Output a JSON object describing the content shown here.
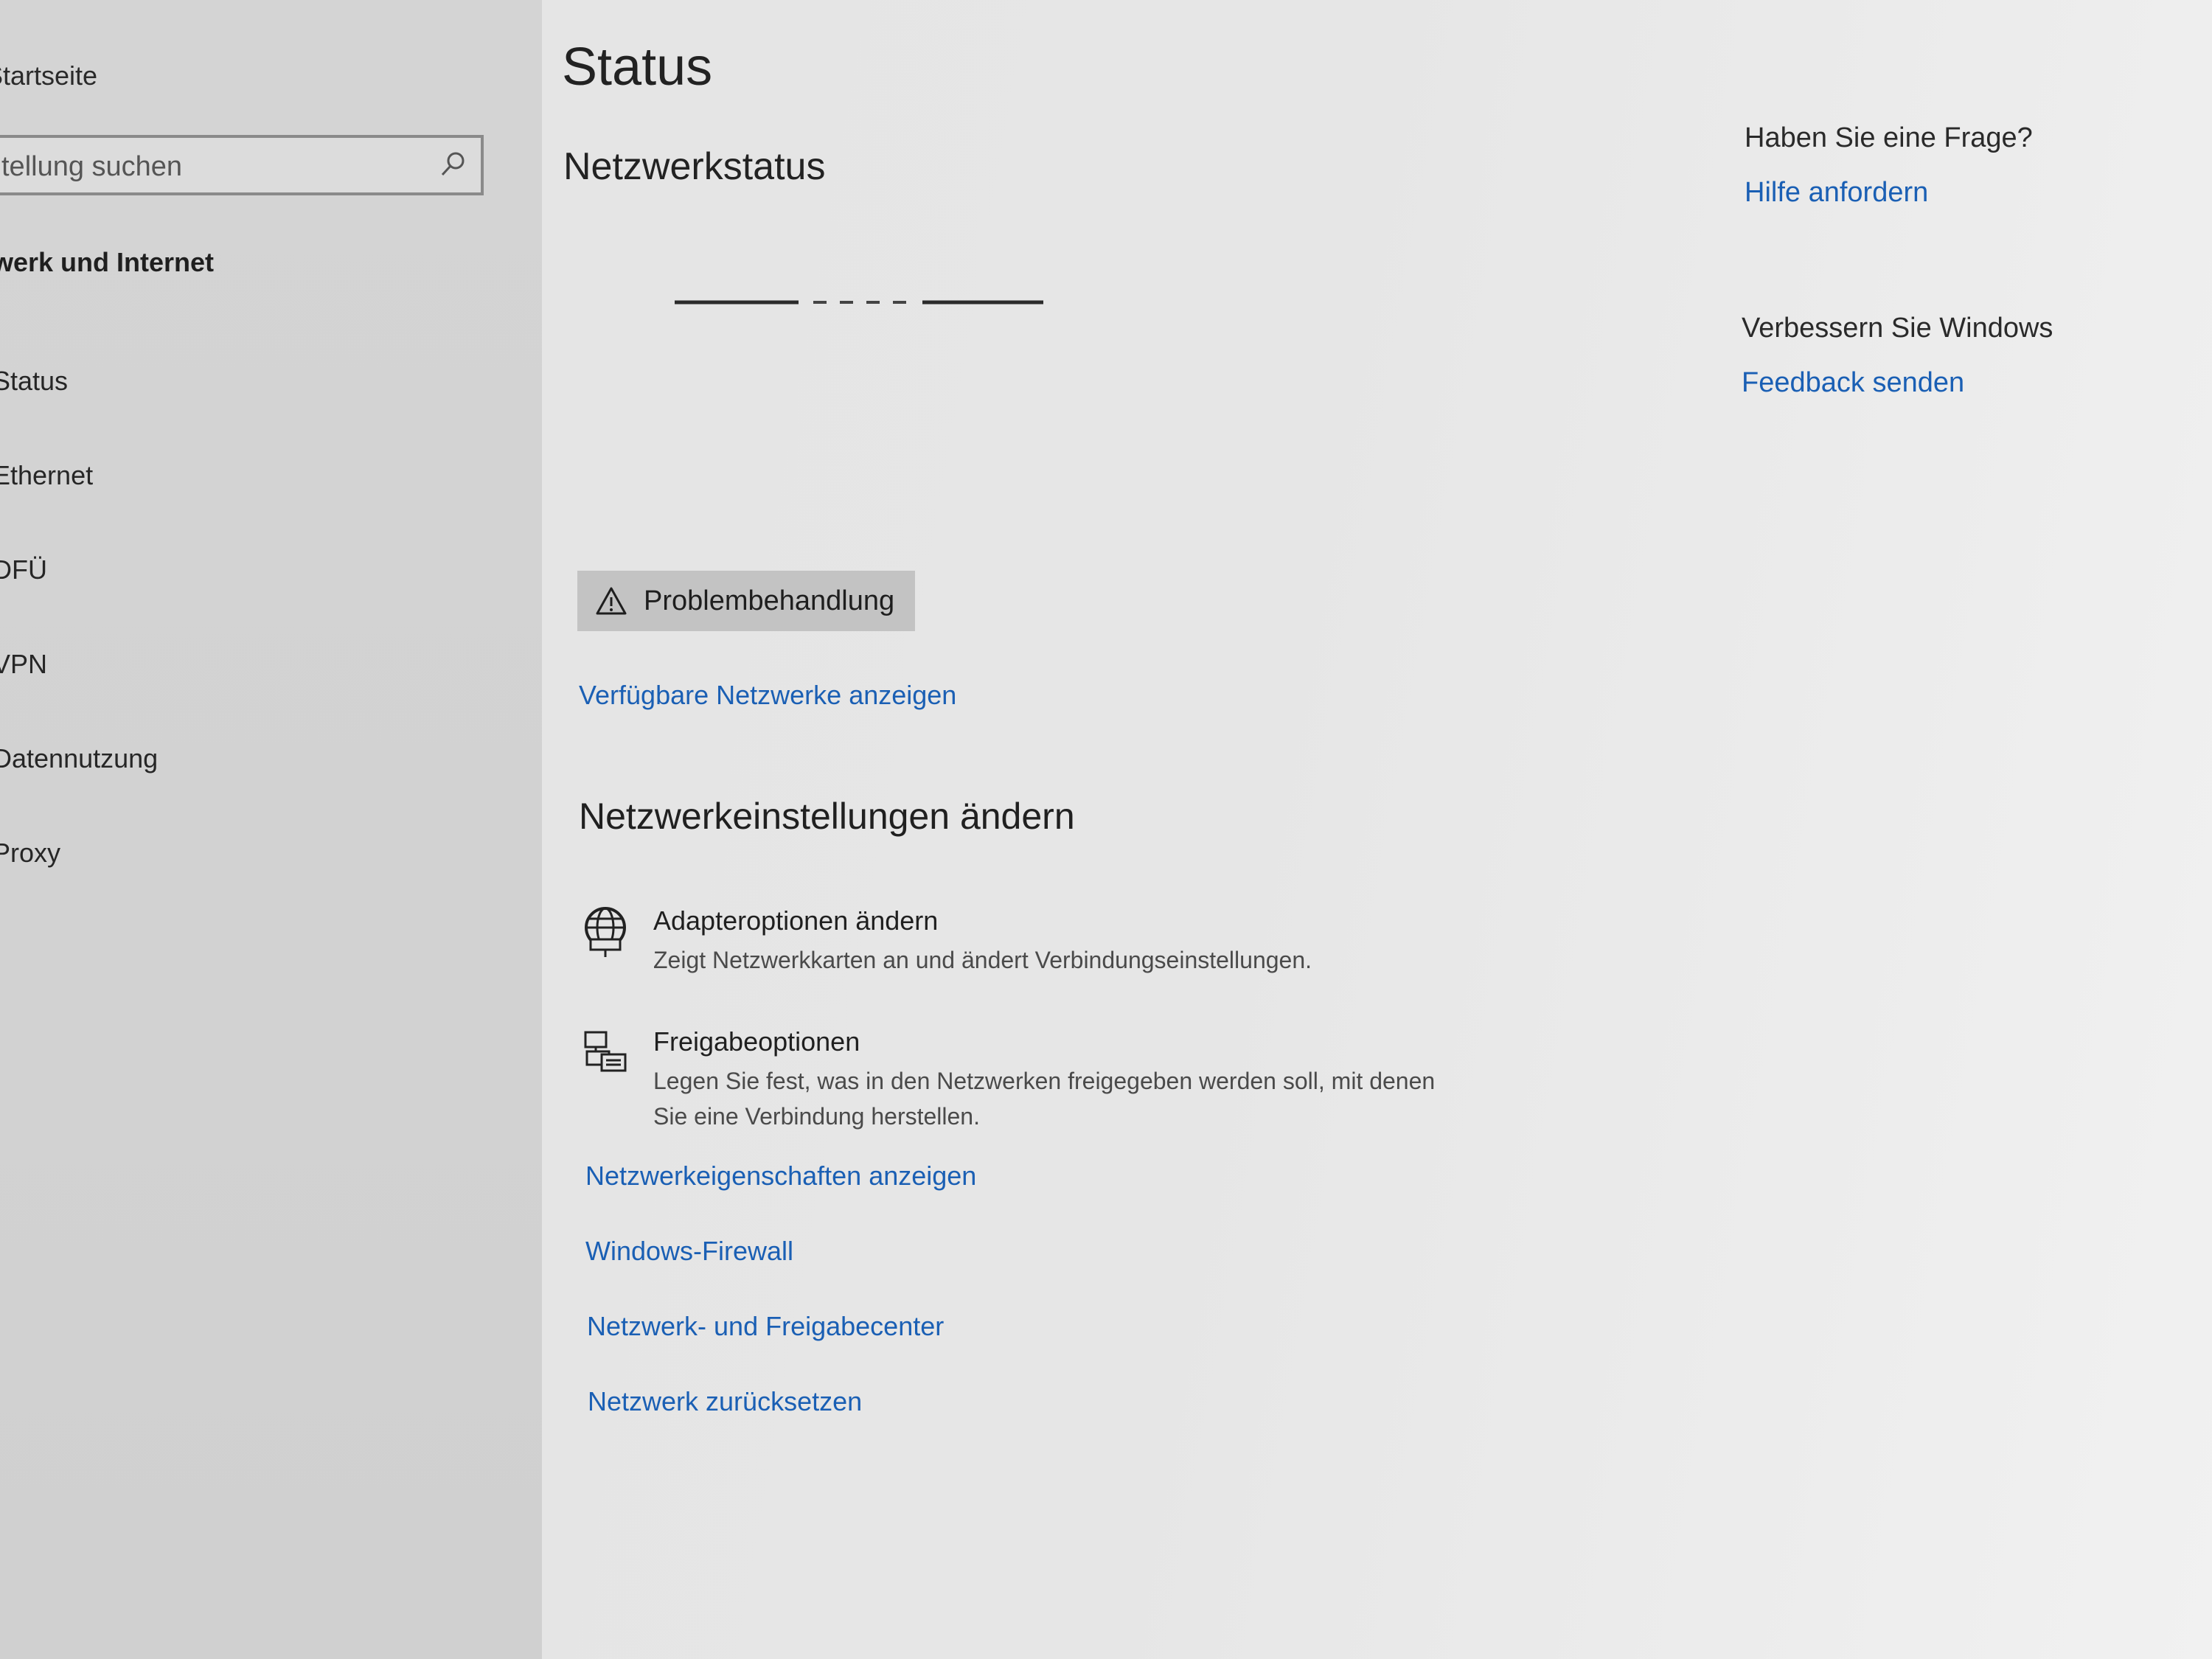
{
  "sidebar": {
    "home_label": "Startseite",
    "search_placeholder": "tellung suchen",
    "section_title": "werk und Internet",
    "items": [
      {
        "label": "Status"
      },
      {
        "label": "Ethernet"
      },
      {
        "label": "DFÜ"
      },
      {
        "label": "VPN"
      },
      {
        "label": "Datennutzung"
      },
      {
        "label": "Proxy"
      }
    ]
  },
  "main": {
    "title": "Status",
    "subtitle": "Netzwerkstatus",
    "troubleshoot_label": "Problembehandlung",
    "available_networks_link": "Verfügbare Netzwerke anzeigen",
    "change_settings_heading": "Netzwerkeinstellungen ändern",
    "options": [
      {
        "icon": "network-adapter-icon",
        "title": "Adapteroptionen ändern",
        "desc": "Zeigt Netzwerkkarten an und ändert Verbindungseinstellungen."
      },
      {
        "icon": "sharing-options-icon",
        "title": "Freigabeoptionen",
        "desc": "Legen Sie fest, was in den Netzwerken freigegeben werden soll, mit denen Sie eine Verbindung herstellen."
      }
    ],
    "links": [
      "Netzwerkeigenschaften anzeigen",
      "Windows-Firewall",
      "Netzwerk- und Freigabecenter",
      "Netzwerk zurücksetzen"
    ]
  },
  "aside": {
    "question_heading": "Haben Sie eine Frage?",
    "help_link": "Hilfe anfordern",
    "improve_heading": "Verbessern Sie Windows",
    "feedback_link": "Feedback senden"
  },
  "colors": {
    "link": "#1a5fb4",
    "sidebar_bg": "#d3d3d3",
    "content_bg": "#e6e6e6",
    "button_bg": "#c3c3c3"
  }
}
